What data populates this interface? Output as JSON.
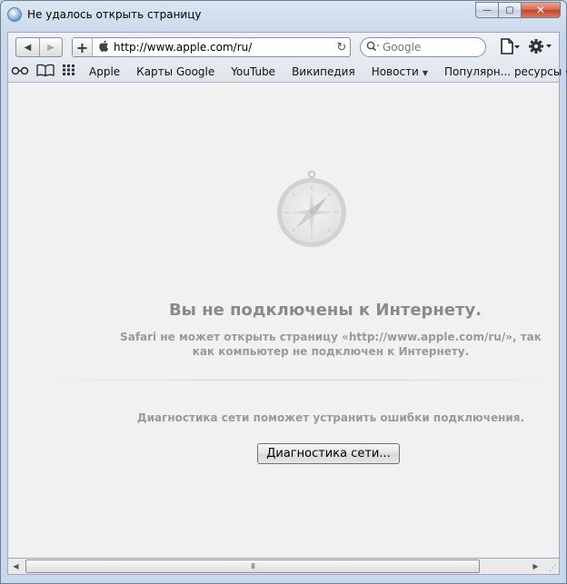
{
  "window": {
    "title": "Не удалось открыть страницу",
    "close_glyph": "✕",
    "minimize_glyph": "—",
    "maximize_glyph": "▢"
  },
  "toolbar": {
    "back_glyph": "◀",
    "forward_glyph": "▶",
    "add_glyph": "+",
    "url": "http://www.apple.com/ru/",
    "reload_glyph": "↻",
    "search_placeholder": "Google",
    "search_icon_glyph": "🔍",
    "page_menu_glyph": "🗋▾",
    "gear_menu_glyph": "⚙▾"
  },
  "bookmarks": {
    "reading_list_glyph": "👓",
    "book_glyph": "📖",
    "grid_glyph": "▦",
    "items": [
      {
        "label": "Apple"
      },
      {
        "label": "Карты Google"
      },
      {
        "label": "YouTube"
      },
      {
        "label": "Википедия"
      },
      {
        "label": "Новости",
        "has_menu": true
      },
      {
        "label": "Популярн... ресурсы",
        "has_menu": true
      }
    ],
    "menu_arrow": "▼"
  },
  "content": {
    "heading": "Вы не подключены к Интернету.",
    "description": "Safari не может открыть страницу «http://www.apple.com/ru/», так как компьютер не подключен к Интернету.",
    "diagnostics_text": "Диагностика сети поможет устранить ошибки подключения.",
    "diagnostics_button": "Диагностика сети..."
  },
  "scrollbar": {
    "left_glyph": "◀",
    "right_glyph": "▶",
    "grip_glyph": "III",
    "resize_glyph": "⋰"
  }
}
